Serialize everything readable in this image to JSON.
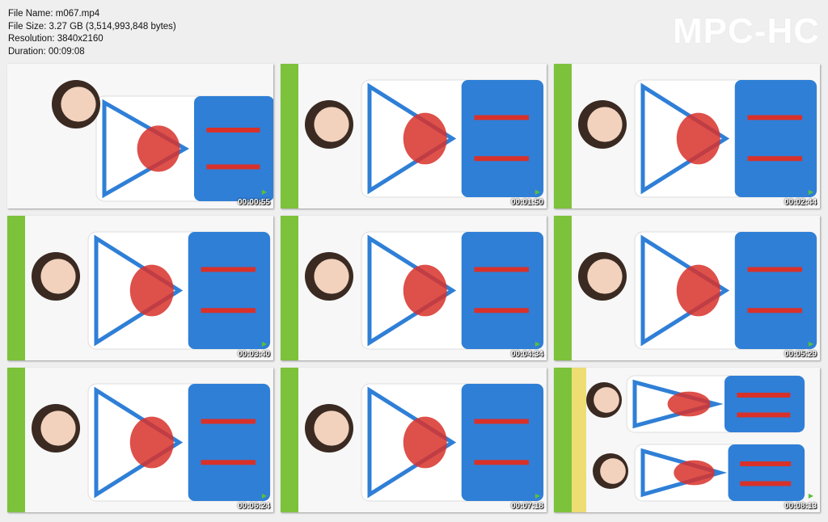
{
  "file_info": {
    "file_name": "File Name: m067.mp4",
    "file_size": "File Size: 3.27 GB (3,514,993,848 bytes)",
    "resolution": "Resolution: 3840x2160",
    "duration": "Duration: 00:09:08"
  },
  "brand": "MPC-HC",
  "thumbnails": [
    {
      "timestamp": "00:00:55",
      "variant": "a"
    },
    {
      "timestamp": "00:01:50",
      "variant": "b"
    },
    {
      "timestamp": "00:02:44",
      "variant": "c"
    },
    {
      "timestamp": "00:03:40",
      "variant": "b"
    },
    {
      "timestamp": "00:04:34",
      "variant": "c"
    },
    {
      "timestamp": "00:05:29",
      "variant": "b"
    },
    {
      "timestamp": "00:06:24",
      "variant": "c"
    },
    {
      "timestamp": "00:07:18",
      "variant": "b"
    },
    {
      "timestamp": "00:08:13",
      "variant": "d"
    }
  ],
  "colors": {
    "uniform_blue": "#2f7fd6",
    "uniform_red": "#d8312a",
    "banner_green": "#7cc23a",
    "banner_yellow": "#e8d23a"
  }
}
